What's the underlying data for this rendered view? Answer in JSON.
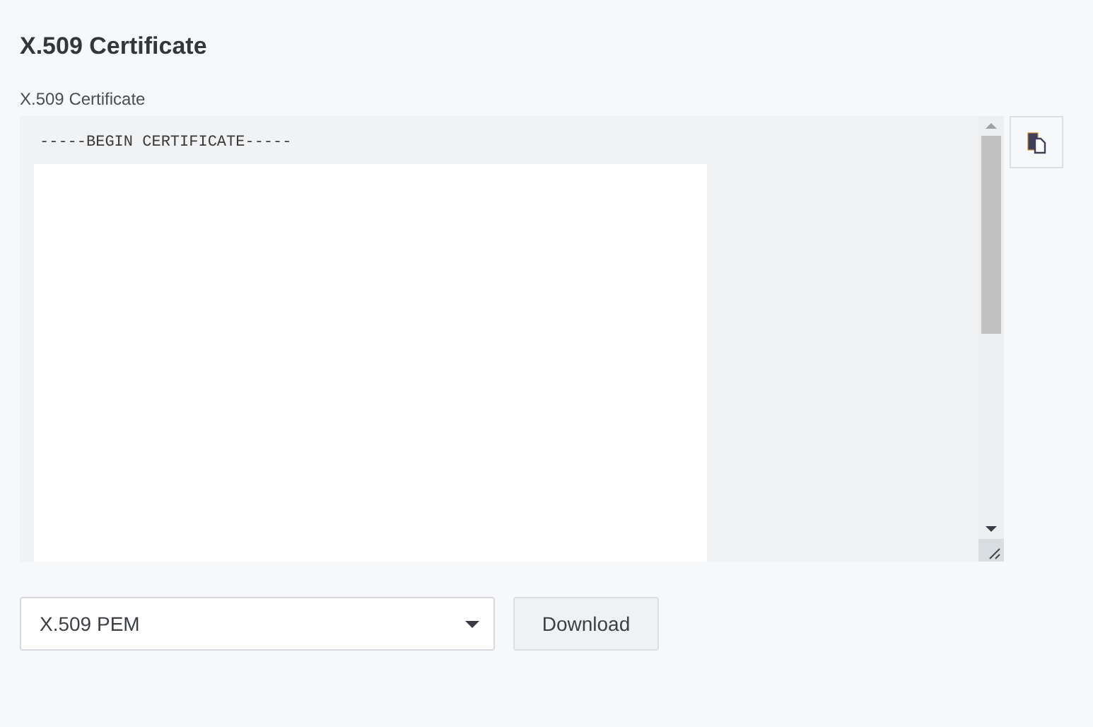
{
  "section": {
    "title": "X.509 Certificate"
  },
  "certificate_field": {
    "label": "X.509 Certificate",
    "value": "-----BEGIN CERTIFICATE-----"
  },
  "format_select": {
    "value": "X.509 PEM"
  },
  "buttons": [
    "Download"
  ]
}
